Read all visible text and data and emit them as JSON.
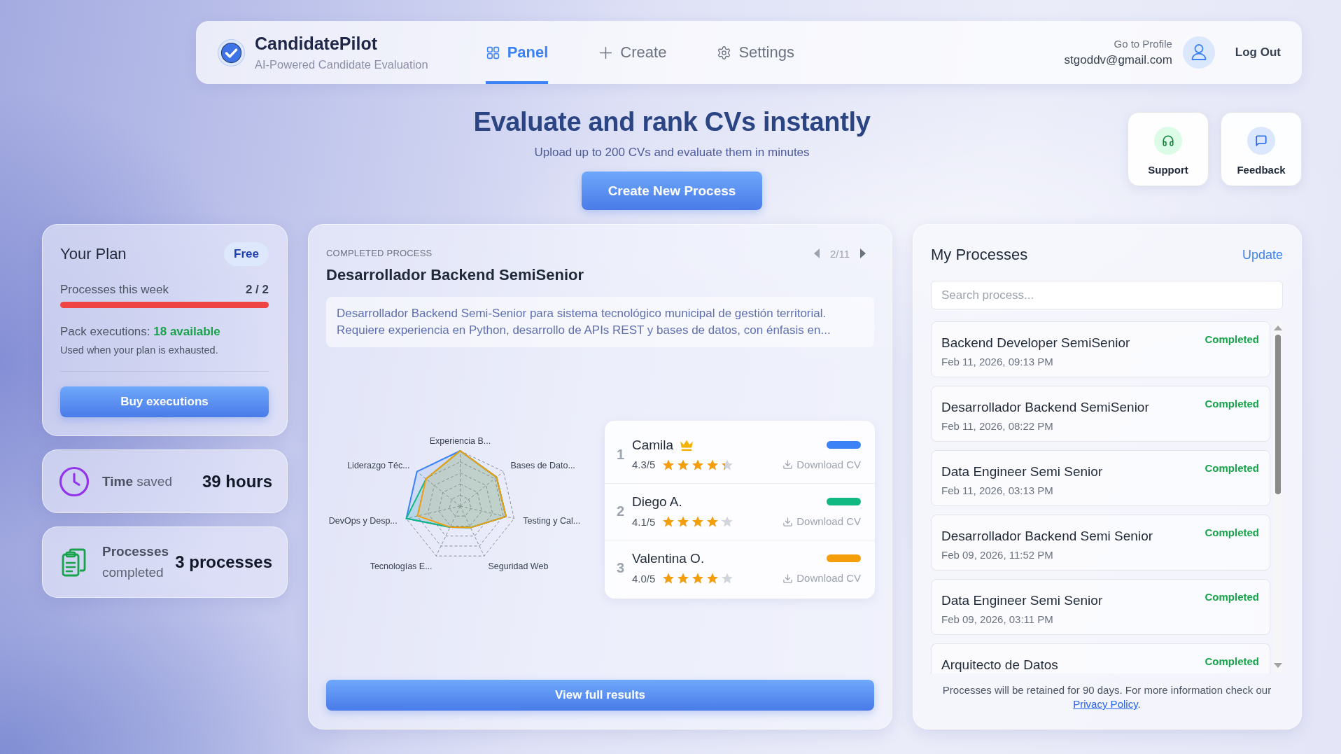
{
  "header": {
    "brand": {
      "name": "CandidatePilot",
      "tagline": "AI-Powered Candidate Evaluation"
    },
    "tabs": [
      {
        "kind": "panel",
        "label": "Panel",
        "selected": true
      },
      {
        "kind": "create",
        "label": "Create",
        "selected": false
      },
      {
        "kind": "settings",
        "label": "Settings",
        "selected": false
      }
    ],
    "profile": {
      "link": "Go to Profile",
      "email": "stgoddv@gmail.com"
    },
    "logout": "Log Out"
  },
  "hero": {
    "title": "Evaluate and rank CVs instantly",
    "subtitle": "Upload up to 200 CVs and evaluate them in minutes",
    "button": "Create New Process"
  },
  "quick_actions": [
    {
      "kind": "support",
      "label": "Support"
    },
    {
      "kind": "feedback",
      "label": "Feedback"
    }
  ],
  "plan": {
    "title": "Your Plan",
    "badge": "Free",
    "usage": {
      "label": "Processes this week",
      "count": "2 / 2",
      "level": 1
    },
    "pack": "Pack executions: **18 available**",
    "note": "Used when your plan is exhausted.",
    "button": "Buy executions"
  },
  "stats": [
    {
      "kind": "time",
      "label": "**Time** saved",
      "value": "39 hours"
    },
    {
      "kind": "processes",
      "label": "**Processes** completed",
      "value": "3 processes"
    }
  ],
  "current_process": {
    "eyebrow": "COMPLETED PROCESS",
    "title": "Desarrollador Backend SemiSenior",
    "pager": "2/11",
    "description": "Desarrollador Backend Semi-Senior para sistema tecnológico municipal de gestión territorial. Requiere experiencia en Python, desarrollo de APIs REST y bases de datos, con énfasis en...",
    "radar_axes": [
      "Experiencia B...",
      "Liderazgo Téc...",
      "Bases de Dato...",
      "DevOps y Desp...",
      "Testing y Cal...",
      "Tecnologías E...",
      "Seguridad Web"
    ],
    "candidates": [
      {
        "rank": "1",
        "name": "Camila",
        "top": true,
        "rating": "4.3/5",
        "stars": 4.3,
        "color": "#3b82f6",
        "download": "Download CV"
      },
      {
        "rank": "2",
        "name": "Diego A.",
        "top": false,
        "rating": "4.1/5",
        "stars": 4.1,
        "color": "#10b981",
        "download": "Download CV"
      },
      {
        "rank": "3",
        "name": "Valentina O.",
        "top": false,
        "rating": "4.0/5",
        "stars": 4.0,
        "color": "#f59e0b",
        "download": "Download CV"
      }
    ],
    "button": "View full results"
  },
  "my_processes": {
    "title": "My Processes",
    "update": "Update",
    "search": {
      "placeholder": "Search process..."
    },
    "items": [
      {
        "name": "Backend Developer SemiSenior",
        "date": "Feb 11, 2026, 09:13 PM",
        "status": "Completed"
      },
      {
        "name": "Desarrollador Backend SemiSenior",
        "date": "Feb 11, 2026, 08:22 PM",
        "status": "Completed"
      },
      {
        "name": "Data Engineer Semi Senior",
        "date": "Feb 11, 2026, 03:13 PM",
        "status": "Completed"
      },
      {
        "name": "Desarrollador Backend Semi Senior",
        "date": "Feb 09, 2026, 11:52 PM",
        "status": "Completed"
      },
      {
        "name": "Data Engineer Semi Senior",
        "date": "Feb 09, 2026, 03:11 PM",
        "status": "Completed"
      },
      {
        "name": "Arquitecto de Datos",
        "status": "Completed"
      }
    ],
    "footer": {
      "text": "Processes will be retained for 90 days. For more information check our",
      "link": "Privacy Policy",
      "after": "."
    }
  }
}
